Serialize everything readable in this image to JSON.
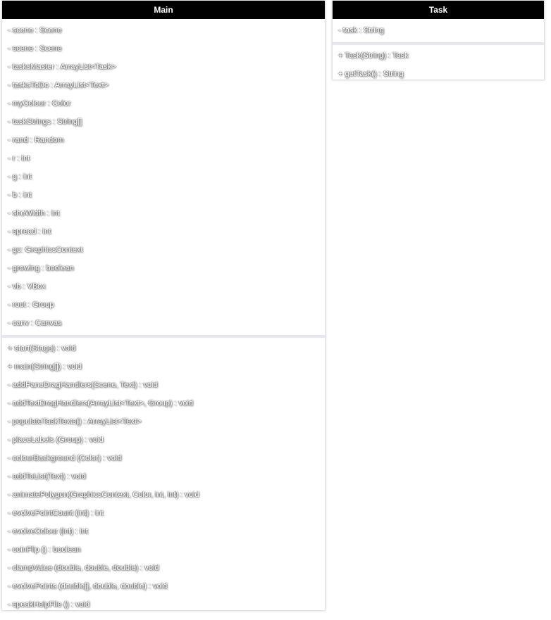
{
  "classes": {
    "main": {
      "name": "Main",
      "attributes": [
        "- scene : Scene",
        "- scene : Scene",
        "- tasksMaster : ArrayList<Task>",
        "- tasksToDo : ArrayList<Text>",
        "- myColour : Color",
        "- taskStrings : String[]",
        "- rand : Random",
        "- r : int",
        "- g : int",
        "- b : int",
        "- sheWidth : int",
        "- spread : int",
        "- gc: GraphicsContext",
        "- growing : boolean",
        "- vb : VBox",
        "- root : Group",
        "- canv : Canvas"
      ],
      "methods": [
        "+ start(Stage) : void",
        "+ main(String[]) : void",
        "- addPaneDragHandlers(Scene, Text) : void",
        "- addTextDragHandlers(ArrayList<Text>, Group) : void",
        "- populateTaskTexts() : ArrayList<Text>",
        "- placeLabels (Group) : void",
        "- colourBackground (Color) : void",
        "- addToList(Text) : void",
        "- animatePolygon(GraphicsContext, Color, int, int) : void",
        "- evolvePointCount (int) : int",
        "- evolveColour (int) : int",
        "- coinFlip () : boolean",
        "- clampValue (double, double, double) : void",
        "- evolvePoints (double[], double, double) : void",
        "- speakHelpFile () : void"
      ]
    },
    "task": {
      "name": "Task",
      "attributes": [
        "- task : String"
      ],
      "methods": [
        "+ Task(String) : Task",
        "+ getTask() : String"
      ]
    }
  }
}
